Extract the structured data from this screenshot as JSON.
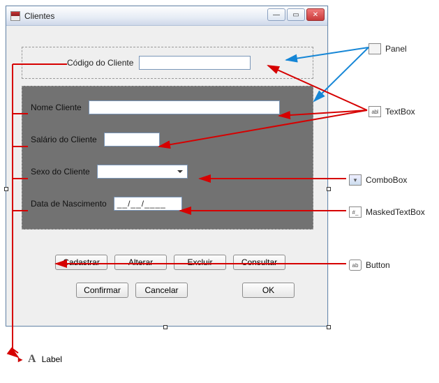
{
  "window": {
    "title": "Clientes"
  },
  "panelTop": {
    "codigoLabel": "Código do Cliente",
    "codigoValue": ""
  },
  "panelGray": {
    "nomeLabel": "Nome Cliente",
    "nomeValue": "",
    "salarioLabel": "Salário do Cliente",
    "salarioValue": "",
    "sexoLabel": "Sexo do Cliente",
    "sexoSelected": "",
    "dataNascLabel": "Data de Nascimento",
    "dataNascMask": "__/__/____"
  },
  "buttons": {
    "cadastrar": "Cadastrar",
    "alterar": "Alterar",
    "excluir": "Excluir",
    "consultar": "Consultar",
    "confirmar": "Confirmar",
    "cancelar": "Cancelar",
    "ok": "OK"
  },
  "legend": {
    "panel": "Panel",
    "textbox": "TextBox",
    "combobox": "ComboBox",
    "maskedtextbox": "MaskedTextBox",
    "button": "Button",
    "label": "Label"
  }
}
